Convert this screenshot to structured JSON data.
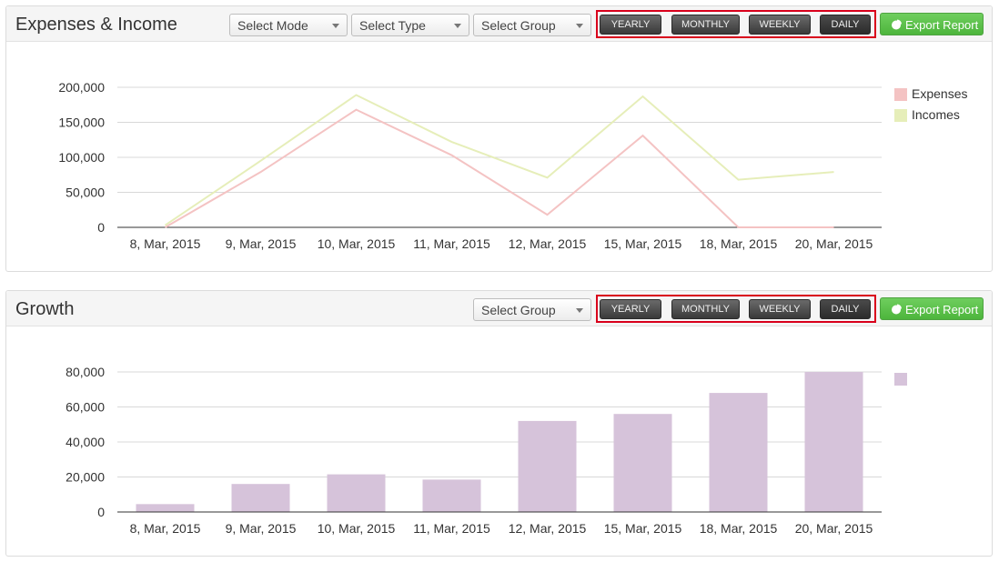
{
  "panels": [
    {
      "title": "Expenses & Income",
      "selects": [
        "Select Mode",
        "Select Type",
        "Select Group"
      ],
      "period_buttons": [
        "YEARLY",
        "MONTHLY",
        "WEEKLY",
        "DAILY"
      ],
      "active_period": "DAILY",
      "export_label": "Export Report",
      "chart_data": {
        "type": "line",
        "categories": [
          "8, Mar, 2015",
          "9, Mar, 2015",
          "10, Mar, 2015",
          "11, Mar, 2015",
          "12, Mar, 2015",
          "15, Mar, 2015",
          "18, Mar, 2015",
          "20, Mar, 2015"
        ],
        "series": [
          {
            "name": "Expenses",
            "color": "#f4c3c3",
            "values": [
              0,
              79000,
              168000,
              103000,
              18000,
              131000,
              0,
              0
            ]
          },
          {
            "name": "Incomes",
            "color": "#e6eeb9",
            "values": [
              3000,
              95000,
              189000,
              122000,
              71000,
              187000,
              68000,
              79000
            ]
          }
        ],
        "yticks": [
          0,
          50000,
          100000,
          150000,
          200000
        ],
        "ylim": [
          0,
          200000
        ],
        "grid": true,
        "legend": "right"
      }
    },
    {
      "title": "Growth",
      "selects": [
        "Select Group"
      ],
      "period_buttons": [
        "YEARLY",
        "MONTHLY",
        "WEEKLY",
        "DAILY"
      ],
      "active_period": "DAILY",
      "export_label": "Export Report",
      "chart_data": {
        "type": "bar",
        "categories": [
          "8, Mar, 2015",
          "9, Mar, 2015",
          "10, Mar, 2015",
          "11, Mar, 2015",
          "12, Mar, 2015",
          "15, Mar, 2015",
          "18, Mar, 2015",
          "20, Mar, 2015"
        ],
        "series": [
          {
            "color": "#d6c3da",
            "values": [
              4500,
              16000,
              21500,
              18500,
              52000,
              56000,
              68000,
              80000
            ]
          }
        ],
        "yticks": [
          0,
          20000,
          40000,
          60000,
          80000
        ],
        "ylim": [
          0,
          80000
        ],
        "grid": true,
        "legend": "right"
      }
    }
  ]
}
